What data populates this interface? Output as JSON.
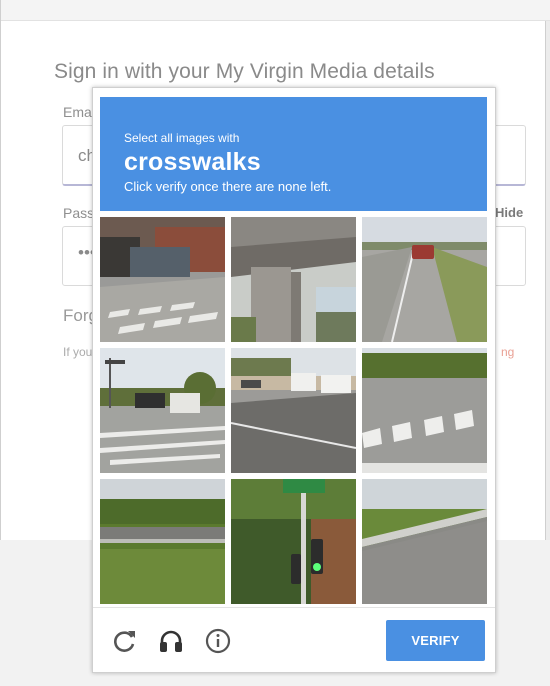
{
  "signin": {
    "title": "Sign in with your My Virgin Media details",
    "email_label": "Emai",
    "email_value": "ch",
    "password_label": "Pass",
    "password_value": "•••",
    "hide_label": "Hide",
    "forgot_label": "Forg",
    "help_text": "If you",
    "help_link_fragment": "ng"
  },
  "captcha": {
    "instruction": "Select all images with",
    "keyword": "crosswalks",
    "hint": "Click verify once there are none left.",
    "verify_label": "VERIFY",
    "tiles": [
      {
        "description": "street corner with painted crosswalk"
      },
      {
        "description": "under a highway overpass"
      },
      {
        "description": "highway with a car"
      },
      {
        "description": "intersection with crosswalk and traffic light"
      },
      {
        "description": "road with parked vans"
      },
      {
        "description": "road with crosswalk stripes"
      },
      {
        "description": "highway with guardrail and grass"
      },
      {
        "description": "green street sign and traffic light"
      },
      {
        "description": "guardrail beside road"
      }
    ],
    "footer_icons": [
      "reload-icon",
      "audio-headphones-icon",
      "info-icon"
    ]
  },
  "colors": {
    "accent": "#4a90e2"
  }
}
